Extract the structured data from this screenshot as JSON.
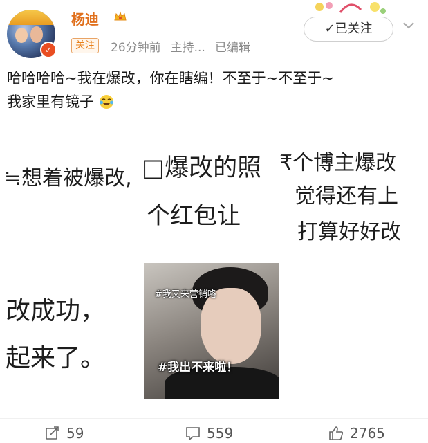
{
  "header": {
    "username": "杨迪",
    "follow_tag": "关注",
    "timestamp": "26分钟前",
    "source": "主持...",
    "edited": "已编辑",
    "followed_button": "✓已关注"
  },
  "post": {
    "line1": "哈哈哈哈~我在爆改，你在瞎编！不至于~不至于~",
    "line2": "我家里有镜子"
  },
  "embedded_text": {
    "frag1": "≒想着被爆改,",
    "frag2": "□爆改的照",
    "frag3": "₹个博主爆改",
    "frag4": "觉得还有上",
    "frag5": "个红包让",
    "frag6": "打算好好改",
    "frag7": "改成功，",
    "frag8": "起来了。"
  },
  "meme": {
    "caption_top": "#我又来营销咯",
    "caption_bottom": "#我出不来啦！"
  },
  "actions": {
    "repost_count": "59",
    "comment_count": "559",
    "like_count": "2765"
  },
  "icons": [
    "crown-icon",
    "verified-badge-icon",
    "chevron-down-icon",
    "laugh-cry-emoji-icon",
    "repost-icon",
    "comment-icon",
    "like-icon"
  ],
  "colors": {
    "username": "#e0701d",
    "follow_tag": "#e9811c",
    "meta": "#8a8a8a"
  }
}
